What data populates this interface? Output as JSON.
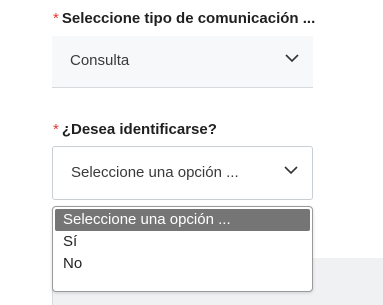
{
  "form": {
    "tipo_comunicacion": {
      "required_mark": "*",
      "label": "Seleccione tipo de comunicación ...",
      "value": "Consulta",
      "icon": "chevron-down-icon"
    },
    "identificarse": {
      "required_mark": "*",
      "label": "¿Desea identificarse?",
      "value": "Seleccione una opción ...",
      "icon": "chevron-down-icon",
      "options": [
        "Seleccione una opción ...",
        "Sí",
        "No"
      ],
      "selected_index": 0
    }
  },
  "colors": {
    "required": "#e53935",
    "selected_option_bg": "#757575",
    "selected_option_text": "#ffffff",
    "field_bg": "#f7f8f9"
  }
}
